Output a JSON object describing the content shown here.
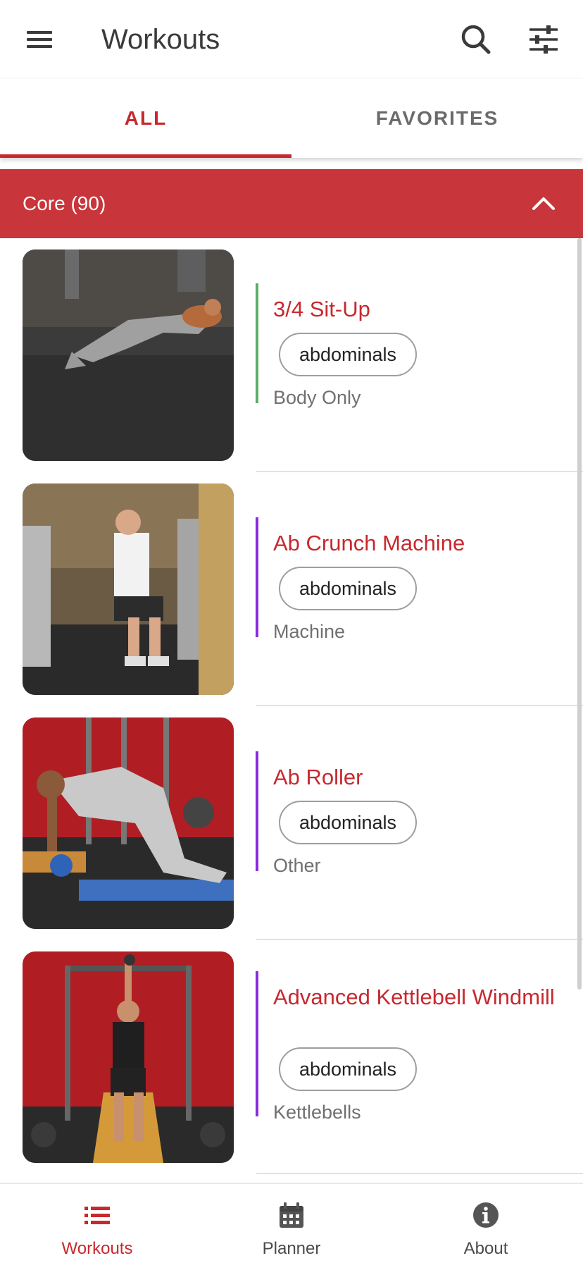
{
  "appbar": {
    "title": "Workouts",
    "menu_icon": "hamburger-menu-icon",
    "search_icon": "search-icon",
    "filter_icon": "sliders-filter-icon"
  },
  "tabs": [
    {
      "label": "ALL",
      "selected": true
    },
    {
      "label": "FAVORITES",
      "selected": false
    }
  ],
  "section": {
    "label": "Core (90)",
    "expanded": true,
    "toggle_icon": "chevron-up-icon"
  },
  "exercises": [
    {
      "name": "3/4 Sit-Up",
      "muscle": "abdominals",
      "equipment": "Body Only",
      "accent": "#5aae6b"
    },
    {
      "name": "Ab Crunch Machine",
      "muscle": "abdominals",
      "equipment": "Machine",
      "accent": "#8a2be2"
    },
    {
      "name": "Ab Roller",
      "muscle": "abdominals",
      "equipment": "Other",
      "accent": "#8a2be2"
    },
    {
      "name": "Advanced Kettlebell Windmill",
      "muscle": "abdominals",
      "equipment": "Kettlebells",
      "accent": "#8a2be2"
    }
  ],
  "bottom_nav": [
    {
      "label": "Workouts",
      "icon": "list-icon",
      "active": true
    },
    {
      "label": "Planner",
      "icon": "calendar-icon",
      "active": false
    },
    {
      "label": "About",
      "icon": "info-icon",
      "active": false
    }
  ],
  "colors": {
    "primary": "#c8282e",
    "section_header": "#c8353b",
    "chip_border": "#9e9e9e",
    "muted_text": "#707070"
  }
}
